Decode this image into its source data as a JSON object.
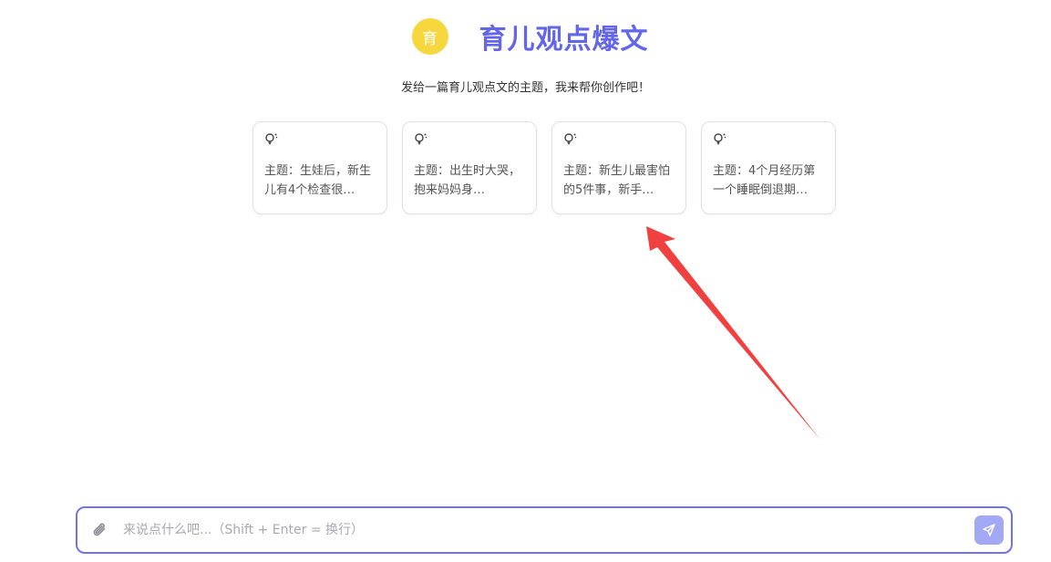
{
  "header": {
    "avatar_text": "育",
    "title": "育儿观点爆文"
  },
  "subtitle": "发给一篇育儿观点文的主题，我来帮你创作吧！",
  "suggestions": [
    {
      "icon": "lightbulb-icon",
      "text": "主题：生娃后，新生儿有4个检查很…"
    },
    {
      "icon": "lightbulb-icon",
      "text": "主题：出生时大哭，抱来妈妈身…"
    },
    {
      "icon": "lightbulb-icon",
      "text": "主题：新生儿最害怕的5件事，新手…"
    },
    {
      "icon": "lightbulb-icon",
      "text": "主题：4个月经历第一个睡眠倒退期…"
    }
  ],
  "input": {
    "placeholder": "来说点什么吧...（Shift + Enter = 换行）",
    "value": ""
  },
  "colors": {
    "accent": "#6366e8",
    "avatar_bg": "#f7d73e",
    "send_button": "#a3a8f4",
    "annotation_arrow": "#f04040"
  }
}
